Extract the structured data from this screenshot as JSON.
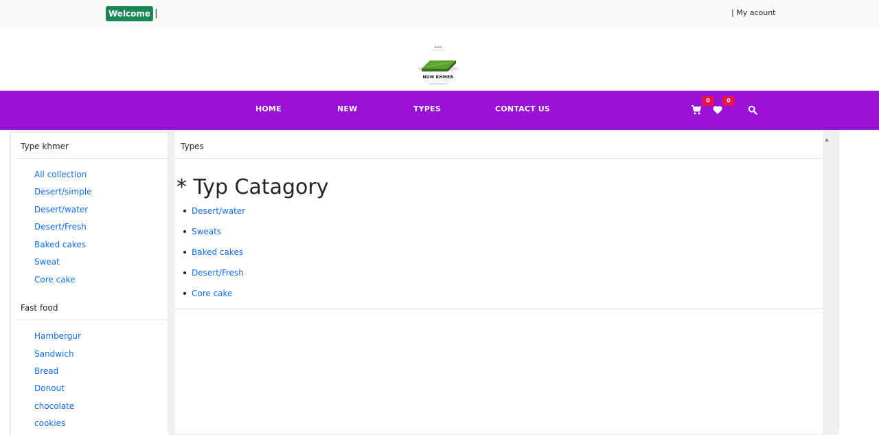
{
  "topbar": {
    "welcome": "Welcome",
    "separator": "|",
    "account": "| My acount"
  },
  "brand": {
    "name": "NUM KHMER"
  },
  "nav": {
    "items": [
      "HOME",
      "NEW",
      "TYPES",
      "CONTACT US"
    ],
    "cart_count": "0",
    "wishlist_count": "0",
    "icons": [
      "cart-icon",
      "heart-icon",
      "search-icon"
    ]
  },
  "sidebar": {
    "section1": {
      "title": "Type khmer",
      "links": [
        "All collection",
        "Desert/simple",
        "Desert/water",
        "Desert/Fresh",
        "Baked cakes",
        "Sweat",
        "Core cake"
      ]
    },
    "section2": {
      "title": "Fast food",
      "links": [
        "Hambergur",
        "Sandwich",
        "Bread",
        "Donout",
        "chocolate",
        "cookies"
      ]
    }
  },
  "main": {
    "title": "Types",
    "heading": "* Typ Catagory",
    "types": [
      "Desert/water",
      "Sweats",
      "Baked cakes",
      "Desert/Fresh",
      "Core cake"
    ]
  },
  "colors": {
    "nav_bg": "#9a12d8",
    "welcome_bg": "#198754",
    "badge_bg": "#e8134f",
    "link": "#0d6efd"
  }
}
